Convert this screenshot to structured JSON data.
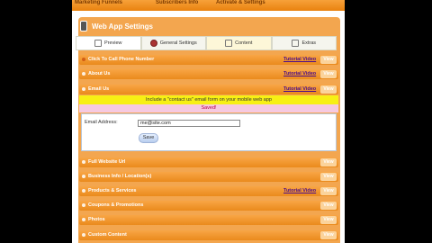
{
  "topnav": {
    "items": [
      "Marketing Funnels",
      "Subscribers Info",
      "Activate & Settings"
    ]
  },
  "panel": {
    "title": "Web App Settings"
  },
  "tabs": [
    {
      "label": "Preview",
      "icon": "phone-icon"
    },
    {
      "label": "General Settings",
      "icon": "gear-icon"
    },
    {
      "label": "Content",
      "icon": "document-icon"
    },
    {
      "label": "Extras",
      "icon": "grid-icon"
    }
  ],
  "rows_top": [
    {
      "label": "Click To Call Phone Number",
      "tutorial": "Tutorial Video",
      "view": "View"
    },
    {
      "label": "About Us",
      "tutorial": "Tutorial Video",
      "view": "View"
    },
    {
      "label": "Email Us",
      "tutorial": "Tutorial Video",
      "view": "View"
    }
  ],
  "email_section": {
    "notice": "Include a \"contact us\" email form on your mobile web app",
    "saved": "Saved!",
    "email_label": "Email Address:",
    "email_value": "me@site.com",
    "save_label": "Save"
  },
  "rows_bottom": [
    {
      "label": "Full Website Url",
      "tutorial": "",
      "view": "View"
    },
    {
      "label": "Business Info / Location(s)",
      "tutorial": "",
      "view": "View"
    },
    {
      "label": "Products & Services",
      "tutorial": "Tutorial Video",
      "view": "View"
    },
    {
      "label": "Coupons & Promotions",
      "tutorial": "",
      "view": "View"
    },
    {
      "label": "Photos",
      "tutorial": "",
      "view": "View"
    },
    {
      "label": "Custom Content",
      "tutorial": "",
      "view": "View"
    }
  ],
  "colors": {
    "accent_orange": "#ea8a1c",
    "notice_yellow": "#f7f014",
    "saved_pink": "#f6c9e0",
    "tutorial_link": "#4a0c8a"
  }
}
